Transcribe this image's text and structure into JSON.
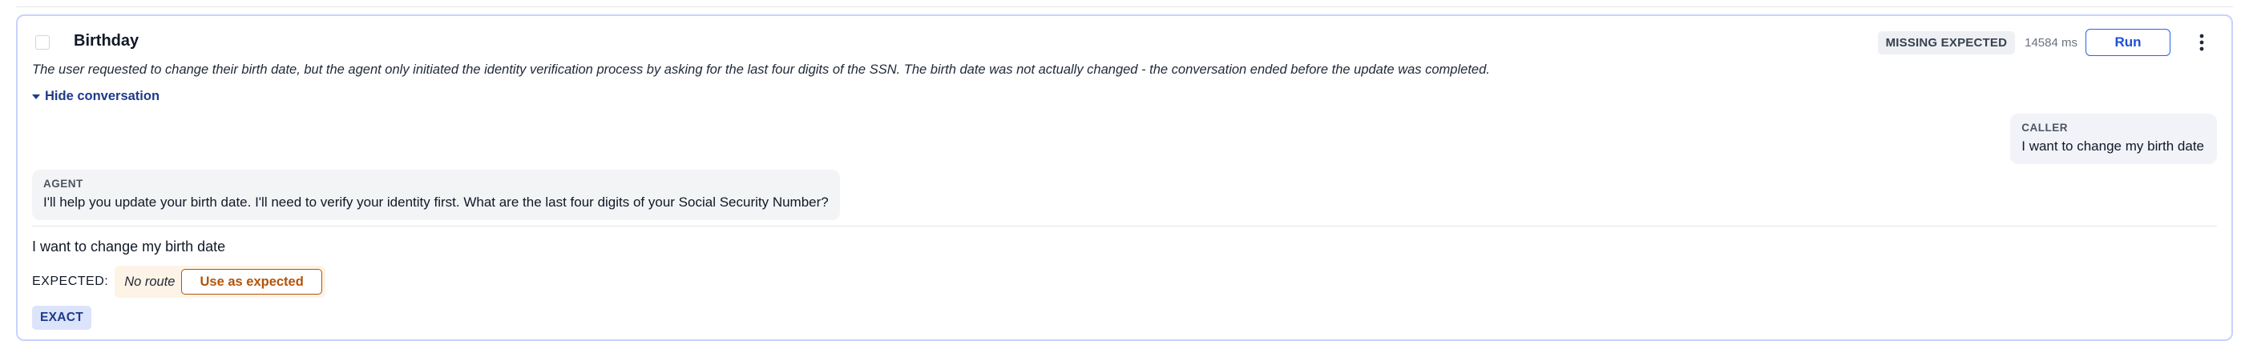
{
  "test": {
    "title": "Birthday",
    "status_badge": "MISSING EXPECTED",
    "duration": "14584 ms",
    "run_label": "Run",
    "summary": "The user requested to change their birth date, but the agent only initiated the identity verification process by asking for the last four digits of the SSN. The birth date was not actually changed - the conversation ended before the update was completed.",
    "toggle_label": "Hide conversation"
  },
  "conversation": [
    {
      "role": "CALLER",
      "text": "I want to change my birth date"
    },
    {
      "role": "AGENT",
      "text": "I'll help you update your birth date. I'll need to verify your identity first. What are the last four digits of your Social Security Number?"
    }
  ],
  "input": {
    "text": "I want to change my birth date"
  },
  "expected": {
    "label": "EXPECTED:",
    "value": "No route",
    "use_button_label": "Use as expected"
  },
  "match_badge": "EXACT",
  "icons": {
    "toggle": "caret-down-icon",
    "menu": "kebab-menu-icon"
  },
  "colors": {
    "card_border": "#c7d2fe",
    "run_accent": "#2563eb",
    "expected_accent": "#b45309",
    "expected_bg": "#fdf3e6",
    "exact_bg": "#dbe4fb"
  }
}
